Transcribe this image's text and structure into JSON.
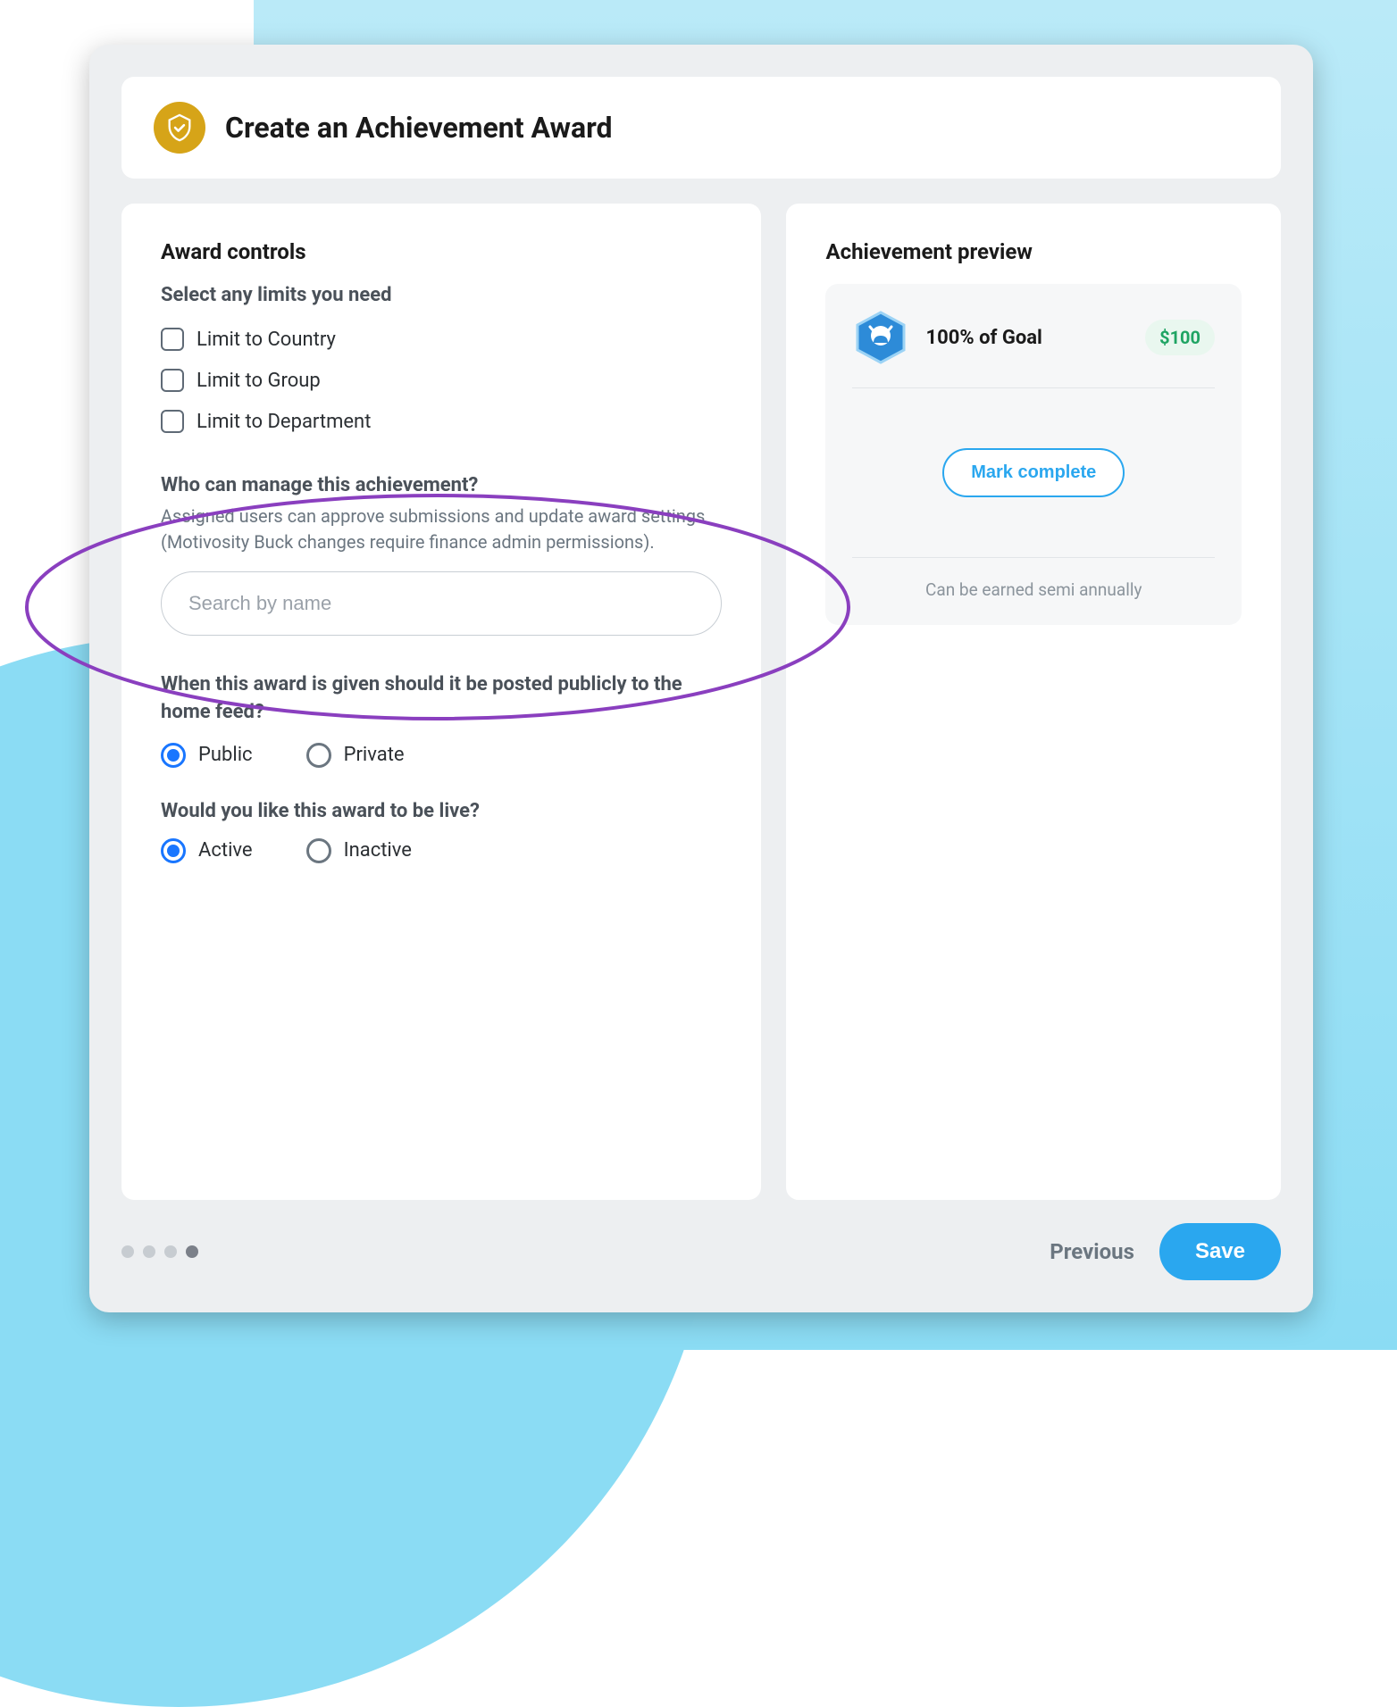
{
  "header": {
    "title": "Create an Achievement Award"
  },
  "award_controls": {
    "section_title": "Award controls",
    "limits_label": "Select any limits you need",
    "limits": [
      {
        "label": "Limit to Country",
        "checked": false
      },
      {
        "label": "Limit to Group",
        "checked": false
      },
      {
        "label": "Limit to Department",
        "checked": false
      }
    ],
    "manage": {
      "label": "Who can manage this achievement?",
      "help": "Assigned users can approve submissions and update award settings (Motivosity Buck changes require finance admin permissions).",
      "search_placeholder": "Search by name"
    },
    "visibility": {
      "label": "When this award is given should it be posted publicly to the home feed?",
      "options": [
        {
          "label": "Public",
          "selected": true
        },
        {
          "label": "Private",
          "selected": false
        }
      ]
    },
    "live": {
      "label": "Would you like this award to be live?",
      "options": [
        {
          "label": "Active",
          "selected": true
        },
        {
          "label": "Inactive",
          "selected": false
        }
      ]
    }
  },
  "preview": {
    "section_title": "Achievement preview",
    "title": "100% of Goal",
    "amount": "$100",
    "button_label": "Mark complete",
    "footer_text": "Can be earned semi annually"
  },
  "footer": {
    "step_count": 4,
    "active_step": 4,
    "previous_label": "Previous",
    "save_label": "Save"
  }
}
